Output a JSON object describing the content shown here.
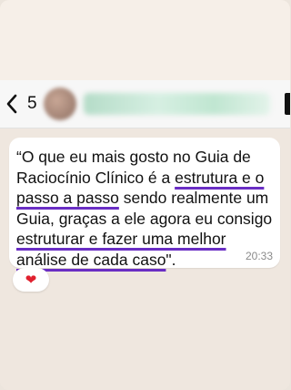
{
  "header": {
    "back_count": "5"
  },
  "message": {
    "parts": [
      {
        "text": "“O que eu mais gosto no Guia de Raciocínio Clínico é a ",
        "highlight": false
      },
      {
        "text": "estrutura e o passo a passo",
        "highlight": true
      },
      {
        "text": " sendo realmente um Guia, graças a ele agora eu consigo ",
        "highlight": false
      },
      {
        "text": "estruturar e fazer uma melhor análise de cada caso",
        "highlight": true
      },
      {
        "text": "\".",
        "highlight": false
      }
    ],
    "time": "20:33",
    "reaction": "❤"
  },
  "colors": {
    "highlight_underline": "#6a2ec4",
    "chat_background": "#efe7df",
    "reaction_heart": "#e0202e"
  }
}
